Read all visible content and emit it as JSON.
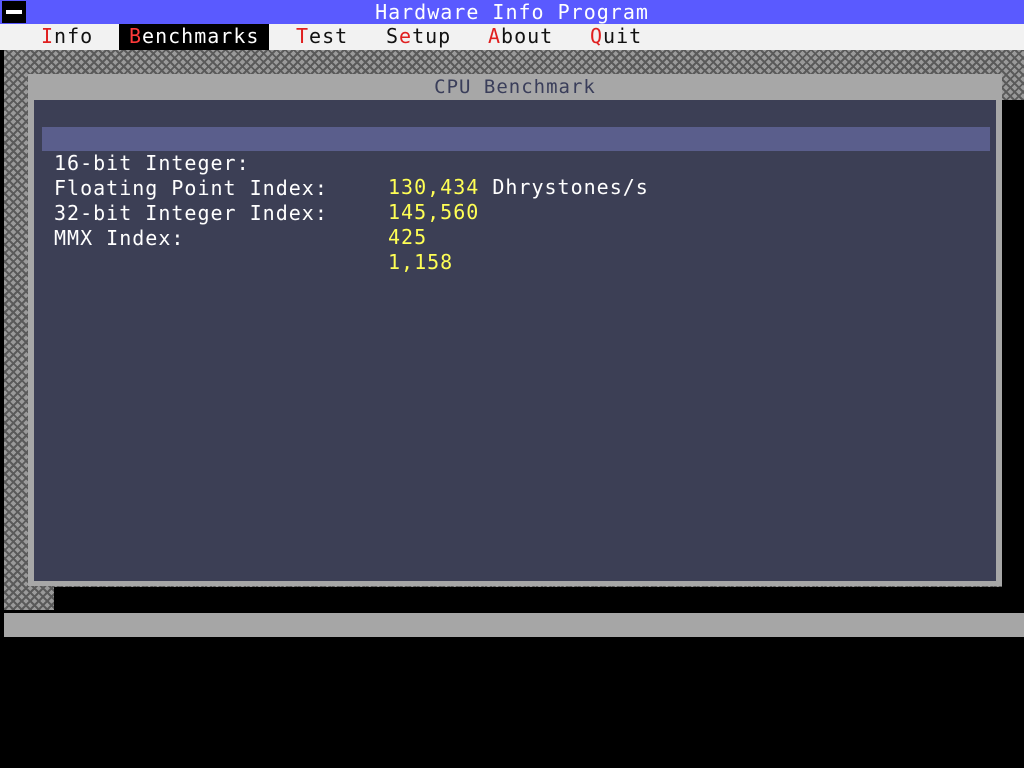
{
  "app": {
    "title": "Hardware Info Program"
  },
  "menu": {
    "items": [
      {
        "hot": "I",
        "rest": "nfo",
        "active": false
      },
      {
        "hot": "B",
        "rest": "enchmarks",
        "active": true
      },
      {
        "hot": "T",
        "rest": "est",
        "active": false
      },
      {
        "pre": "S",
        "hot": "e",
        "rest": "tup",
        "active": false
      },
      {
        "hot": "A",
        "rest": "bout",
        "active": false
      },
      {
        "hot": "Q",
        "rest": "uit",
        "active": false
      }
    ]
  },
  "window": {
    "title": "CPU Benchmark",
    "rows": [
      {
        "label": "16-bit Integer:",
        "value": "130,434",
        "unit": " Dhrystones/s",
        "selected": true
      },
      {
        "label": "Floating Point Index:",
        "value": "145,560",
        "unit": "",
        "selected": false
      },
      {
        "label": "32-bit Integer Index:",
        "value": "425",
        "unit": "",
        "selected": false
      },
      {
        "label": "MMX Index:",
        "value": "1,158",
        "unit": "",
        "selected": false
      }
    ]
  },
  "colors": {
    "titlebar": "#5a5aff",
    "hotkey": "#e02020",
    "value": "#ffff55",
    "panel": "#3c3f55",
    "selection": "#5a5e8c"
  },
  "icons": {
    "system_menu": "system-menu-icon"
  }
}
